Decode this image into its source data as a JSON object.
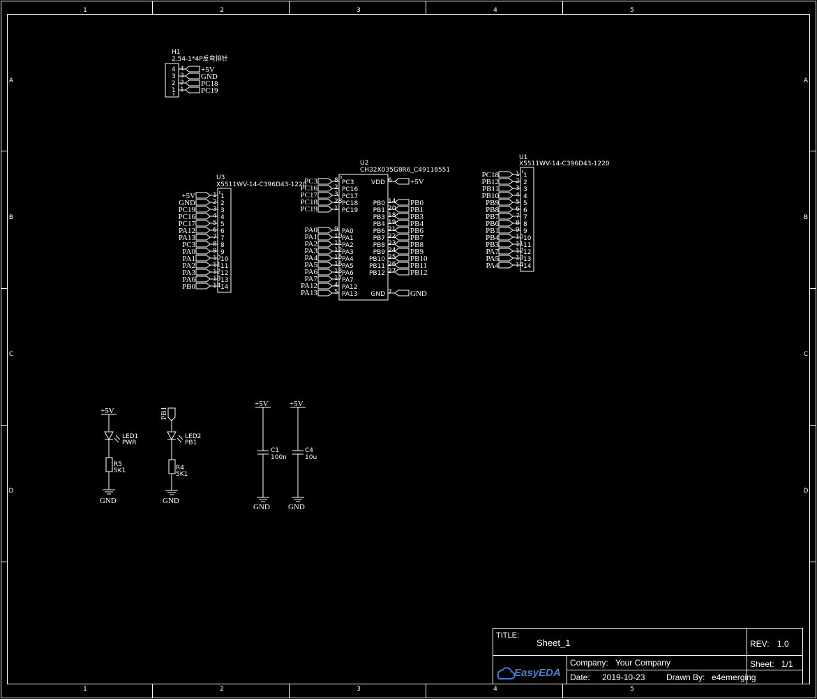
{
  "sheet": {
    "cols": [
      "1",
      "2",
      "3",
      "4",
      "5"
    ],
    "rows": [
      "A",
      "B",
      "C",
      "D"
    ]
  },
  "h1": {
    "ref": "H1",
    "value": "2.54-1*4P反弯排针",
    "pins": [
      "4",
      "3",
      "2",
      "1"
    ],
    "nets": [
      "+5V",
      "GND",
      "PC18",
      "PC19"
    ]
  },
  "u3": {
    "ref": "U3",
    "value": "X5511WV-14-C396D43-1220",
    "nets": [
      "+5V",
      "GND",
      "PC19",
      "PC16",
      "PC17",
      "PA12",
      "PA13",
      "PC3",
      "PA0",
      "PA1",
      "PA2",
      "PA3",
      "PA6",
      "PB0"
    ],
    "pins": [
      "1",
      "2",
      "3",
      "4",
      "5",
      "6",
      "7",
      "8",
      "9",
      "10",
      "11",
      "12",
      "13",
      "14"
    ]
  },
  "u2": {
    "ref": "U2",
    "value": "CH32X035G8R6_C49118551",
    "left": [
      {
        "net": "PC3",
        "num": "8",
        "name": "PC3"
      },
      {
        "net": "PC16",
        "num": "2",
        "name": "PC16"
      },
      {
        "net": "PC17",
        "num": "3",
        "name": "PC17"
      },
      {
        "net": "PC18",
        "num": "28",
        "name": "PC18"
      },
      {
        "net": "PC19",
        "num": "1",
        "name": "PC19"
      },
      {
        "net": "PA0",
        "num": "9",
        "name": "PA0"
      },
      {
        "net": "PA1",
        "num": "10",
        "name": "PA1"
      },
      {
        "net": "PA2",
        "num": "11",
        "name": "PA2"
      },
      {
        "net": "PA3",
        "num": "12",
        "name": "PA3"
      },
      {
        "net": "PA4",
        "num": "15",
        "name": "PA4"
      },
      {
        "net": "PA5",
        "num": "16",
        "name": "PA5"
      },
      {
        "net": "PA6",
        "num": "13",
        "name": "PA6"
      },
      {
        "net": "PA7",
        "num": "17",
        "name": "PA7"
      },
      {
        "net": "PA12",
        "num": "4",
        "name": "PA12"
      },
      {
        "net": "PA13",
        "num": "5",
        "name": "PA13"
      }
    ],
    "right": [
      {
        "net": "+5V",
        "num": "6",
        "name": "VDD"
      },
      {
        "net": "PB0",
        "num": "14",
        "name": "PB0"
      },
      {
        "net": "PB1",
        "num": "20",
        "name": "PB1"
      },
      {
        "net": "PB3",
        "num": "18",
        "name": "PB3"
      },
      {
        "net": "PB4",
        "num": "19",
        "name": "PB4"
      },
      {
        "net": "PB6",
        "num": "21",
        "name": "PB6"
      },
      {
        "net": "PB7",
        "num": "22",
        "name": "PB7"
      },
      {
        "net": "PB8",
        "num": "23",
        "name": "PB8"
      },
      {
        "net": "PB9",
        "num": "24",
        "name": "PB9"
      },
      {
        "net": "PB10",
        "num": "25",
        "name": "PB10"
      },
      {
        "net": "PB11",
        "num": "26",
        "name": "PB11"
      },
      {
        "net": "PB12",
        "num": "27",
        "name": "PB12"
      },
      {
        "net": "GND",
        "num": "7",
        "name": "GND"
      }
    ]
  },
  "u1": {
    "ref": "U1",
    "value": "X5511WV-14-C396D43-1220",
    "nets": [
      "PC18",
      "PB12",
      "PB11",
      "PB10",
      "PB9",
      "PB8",
      "PB7",
      "PB6",
      "PB1",
      "PB4",
      "PB3",
      "PA7",
      "PA5",
      "PA4"
    ],
    "pins": [
      "1",
      "2",
      "3",
      "4",
      "5",
      "6",
      "7",
      "8",
      "9",
      "10",
      "11",
      "12",
      "13",
      "14"
    ]
  },
  "led1": {
    "ref": "LED1",
    "value": "PWR",
    "top": "+5V"
  },
  "r5": {
    "ref": "R5",
    "value": "5K1",
    "gnd": "GND"
  },
  "led2": {
    "ref": "LED2",
    "value": "PB1",
    "top": "PB1"
  },
  "r4": {
    "ref": "R4",
    "value": "5K1",
    "gnd": "GND"
  },
  "c1": {
    "ref": "C1",
    "value": "100n",
    "top": "+5V",
    "gnd": "GND"
  },
  "c4": {
    "ref": "C4",
    "value": "10u",
    "top": "+5V",
    "gnd": "GND"
  },
  "titleblock": {
    "title_label": "TITLE:",
    "title": "Sheet_1",
    "rev_label": "REV:",
    "rev": "1.0",
    "company_label": "Company:",
    "company": "Your Company",
    "sheet_label": "Sheet:",
    "sheet": "1/1",
    "date_label": "Date:",
    "date": "2019-10-23",
    "drawn_label": "Drawn By:",
    "drawn": "e4emerging",
    "logo": "EasyEDA"
  }
}
